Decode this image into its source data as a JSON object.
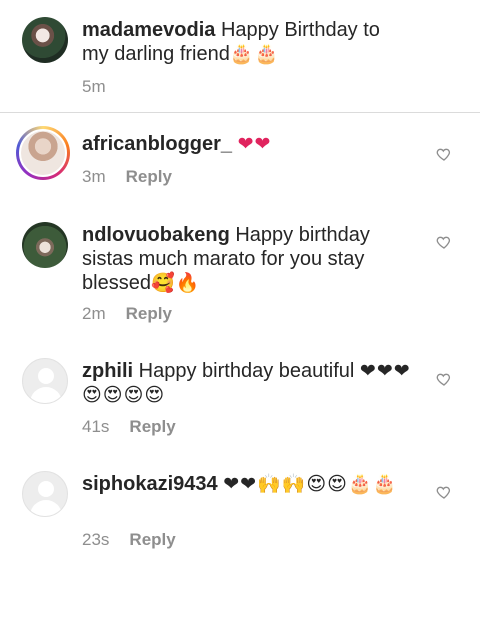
{
  "caption": {
    "username": "madamevodia",
    "text": " Happy Birthday to my darling friend",
    "emoji": "🎂🎂",
    "time": "5m"
  },
  "comments": [
    {
      "username": "africanblogger_",
      "text": " ",
      "emoji": "❤❤",
      "time": "3m",
      "reply": "Reply"
    },
    {
      "username": "ndlovuobakeng",
      "text": " Happy birthday sistas much marato for you stay blessed",
      "emoji": "🥰🔥",
      "time": "2m",
      "reply": "Reply"
    },
    {
      "username": "zphili",
      "text": " Happy birthday beautiful ",
      "emoji": "❤❤❤😍😍😍😍",
      "time": "41s",
      "reply": "Reply"
    },
    {
      "username": "siphokazi9434",
      "text": " ",
      "emoji": "❤❤🙌🙌😍😍🎂🎂",
      "time": "23s",
      "reply": "Reply"
    }
  ],
  "icons": {
    "like": "heart-outline-icon"
  },
  "colors": {
    "text": "#262626",
    "muted": "#8e8e8e",
    "emoji_red": "#e0245e"
  }
}
